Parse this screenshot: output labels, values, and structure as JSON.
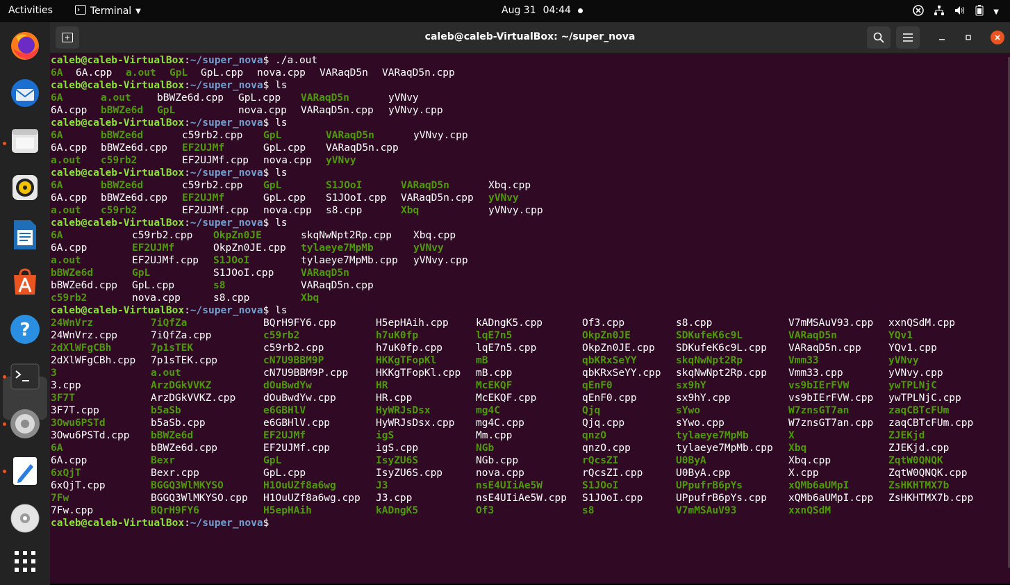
{
  "topbar": {
    "activities": "Activities",
    "app_name": "Terminal",
    "date": "Aug 31",
    "time": "04:44"
  },
  "dock": {
    "apps": [
      "firefox-icon",
      "thunderbird-icon",
      "files-icon",
      "rhythmbox-icon",
      "libreoffice-writer-icon",
      "app-center-icon",
      "help-icon",
      "terminal-icon",
      "settings-icon",
      "text-editor-icon",
      "disc-icon",
      "show-apps-icon"
    ]
  },
  "window": {
    "title": "caleb@caleb-VirtualBox: ~/super_nova"
  },
  "colors": {
    "terminal_bg": "#300a24",
    "prompt_user": "#8ae234",
    "prompt_path": "#729fcf",
    "executable": "#4e9a06",
    "accent_close": "#e95420"
  },
  "prompt": {
    "user": "caleb@caleb-VirtualBox",
    "sep": ":",
    "path": "~/super_nova",
    "dollar": "$ "
  },
  "commands": [
    "./a.out",
    "ls",
    "ls",
    "ls",
    "ls",
    "ls",
    "ls"
  ],
  "outputs": [
    [
      [
        [
          "6A",
          "g"
        ],
        [
          "6A.cpp",
          "f"
        ],
        [
          "a.out",
          "g"
        ],
        [
          "GpL",
          "g"
        ],
        [
          "GpL.cpp",
          "f"
        ],
        [
          "nova.cpp",
          "f"
        ],
        [
          "VARaqD5n",
          "f"
        ],
        [
          "VARaqD5n.cpp",
          "f"
        ]
      ]
    ],
    [
      [
        [
          "6A",
          "g"
        ],
        [
          "a.out",
          "g"
        ],
        [
          "bBWZe6d.cpp",
          "f"
        ],
        [
          "GpL.cpp",
          "f"
        ],
        [
          "VARaqD5n",
          "g"
        ],
        [
          "yVNvy",
          "f"
        ]
      ],
      [
        [
          "6A.cpp",
          "f"
        ],
        [
          "bBWZe6d",
          "g"
        ],
        [
          "GpL",
          "g"
        ],
        [
          "nova.cpp",
          "f"
        ],
        [
          "VARaqD5n.cpp",
          "f"
        ],
        [
          "yVNvy.cpp",
          "f"
        ]
      ]
    ],
    [
      [
        [
          "6A",
          "g"
        ],
        [
          "bBWZe6d",
          "g"
        ],
        [
          "c59rb2.cpp",
          "f"
        ],
        [
          "GpL",
          "g"
        ],
        [
          "VARaqD5n",
          "g"
        ],
        [
          "yVNvy.cpp",
          "f"
        ]
      ],
      [
        [
          "6A.cpp",
          "f"
        ],
        [
          "bBWZe6d.cpp",
          "f"
        ],
        [
          "EF2UJMf",
          "g"
        ],
        [
          "GpL.cpp",
          "f"
        ],
        [
          "VARaqD5n.cpp",
          "f"
        ]
      ],
      [
        [
          "a.out",
          "g"
        ],
        [
          "c59rb2",
          "g"
        ],
        [
          "EF2UJMf.cpp",
          "f"
        ],
        [
          "nova.cpp",
          "f"
        ],
        [
          "yVNvy",
          "g"
        ]
      ]
    ],
    [
      [
        [
          "6A",
          "g"
        ],
        [
          "bBWZe6d",
          "g"
        ],
        [
          "c59rb2.cpp",
          "f"
        ],
        [
          "GpL",
          "g"
        ],
        [
          "S1JOoI",
          "g"
        ],
        [
          "VARaqD5n",
          "g"
        ],
        [
          "Xbq.cpp",
          "f"
        ]
      ],
      [
        [
          "6A.cpp",
          "f"
        ],
        [
          "bBWZe6d.cpp",
          "f"
        ],
        [
          "EF2UJMf",
          "g"
        ],
        [
          "GpL.cpp",
          "f"
        ],
        [
          "S1JOoI.cpp",
          "f"
        ],
        [
          "VARaqD5n.cpp",
          "f"
        ],
        [
          "yVNvy",
          "g"
        ]
      ],
      [
        [
          "a.out",
          "g"
        ],
        [
          "c59rb2",
          "g"
        ],
        [
          "EF2UJMf.cpp",
          "f"
        ],
        [
          "nova.cpp",
          "f"
        ],
        [
          "s8.cpp",
          "f"
        ],
        [
          "Xbq",
          "g"
        ],
        [
          "yVNvy.cpp",
          "f"
        ]
      ]
    ],
    [
      [
        [
          "6A",
          "g"
        ],
        [
          "c59rb2.cpp",
          "f"
        ],
        [
          "OkpZn0JE",
          "g"
        ],
        [
          "skqNwNpt2Rp.cpp",
          "f"
        ],
        [
          "Xbq.cpp",
          "f"
        ]
      ],
      [
        [
          "6A.cpp",
          "f"
        ],
        [
          "EF2UJMf",
          "g"
        ],
        [
          "OkpZn0JE.cpp",
          "f"
        ],
        [
          "tylaeye7MpMb",
          "g"
        ],
        [
          "yVNvy",
          "g"
        ]
      ],
      [
        [
          "a.out",
          "g"
        ],
        [
          "EF2UJMf.cpp",
          "f"
        ],
        [
          "S1JOoI",
          "g"
        ],
        [
          "tylaeye7MpMb.cpp",
          "f"
        ],
        [
          "yVNvy.cpp",
          "f"
        ]
      ],
      [
        [
          "bBWZe6d",
          "g"
        ],
        [
          "GpL",
          "g"
        ],
        [
          "S1JOoI.cpp",
          "f"
        ],
        [
          "VARaqD5n",
          "g"
        ]
      ],
      [
        [
          "bBWZe6d.cpp",
          "f"
        ],
        [
          "GpL.cpp",
          "f"
        ],
        [
          "s8",
          "g"
        ],
        [
          "VARaqD5n.cpp",
          "f"
        ]
      ],
      [
        [
          "c59rb2",
          "g"
        ],
        [
          "nova.cpp",
          "f"
        ],
        [
          "s8.cpp",
          "f"
        ],
        [
          "Xbq",
          "g"
        ]
      ]
    ],
    [
      [
        [
          "24WnVrz",
          "g"
        ],
        [
          "7iQfZa",
          "g"
        ],
        [
          "BQrH9FY6.cpp",
          "f"
        ],
        [
          "H5epHAih.cpp",
          "f"
        ],
        [
          "kADngK5.cpp",
          "f"
        ],
        [
          "Of3.cpp",
          "f"
        ],
        [
          "s8.cpp",
          "f"
        ],
        [
          "V7mMSAuV93.cpp",
          "f"
        ],
        [
          "xxnQSdM.cpp",
          "f"
        ]
      ],
      [
        [
          "24WnVrz.cpp",
          "f"
        ],
        [
          "7iQfZa.cpp",
          "f"
        ],
        [
          "c59rb2",
          "g"
        ],
        [
          "h7uK0fp",
          "g"
        ],
        [
          "lqE7n5",
          "g"
        ],
        [
          "OkpZn0JE",
          "g"
        ],
        [
          "SDKufeK6c9L",
          "g"
        ],
        [
          "VARaqD5n",
          "g"
        ],
        [
          "YQv1",
          "g"
        ]
      ],
      [
        [
          "2dXlWFgCBh",
          "g"
        ],
        [
          "7p1sTEK",
          "g"
        ],
        [
          "c59rb2.cpp",
          "f"
        ],
        [
          "h7uK0fp.cpp",
          "f"
        ],
        [
          "lqE7n5.cpp",
          "f"
        ],
        [
          "OkpZn0JE.cpp",
          "f"
        ],
        [
          "SDKufeK6c9L.cpp",
          "f"
        ],
        [
          "VARaqD5n.cpp",
          "f"
        ],
        [
          "YQv1.cpp",
          "f"
        ]
      ],
      [
        [
          "2dXlWFgCBh.cpp",
          "f"
        ],
        [
          "7p1sTEK.cpp",
          "f"
        ],
        [
          "cN7U9BBM9P",
          "g"
        ],
        [
          "HKKgTFopKl",
          "g"
        ],
        [
          "mB",
          "g"
        ],
        [
          "qbKRxSeYY",
          "g"
        ],
        [
          "skqNwNpt2Rp",
          "g"
        ],
        [
          "Vmm33",
          "g"
        ],
        [
          "yVNvy",
          "g"
        ]
      ],
      [
        [
          "3",
          "g"
        ],
        [
          "a.out",
          "g"
        ],
        [
          "cN7U9BBM9P.cpp",
          "f"
        ],
        [
          "HKKgTFopKl.cpp",
          "f"
        ],
        [
          "mB.cpp",
          "f"
        ],
        [
          "qbKRxSeYY.cpp",
          "f"
        ],
        [
          "skqNwNpt2Rp.cpp",
          "f"
        ],
        [
          "Vmm33.cpp",
          "f"
        ],
        [
          "yVNvy.cpp",
          "f"
        ]
      ],
      [
        [
          "3.cpp",
          "f"
        ],
        [
          "ArzDGkVVKZ",
          "g"
        ],
        [
          "dOuBwdYw",
          "g"
        ],
        [
          "HR",
          "g"
        ],
        [
          "McEKQF",
          "g"
        ],
        [
          "qEnF0",
          "g"
        ],
        [
          "sx9hY",
          "g"
        ],
        [
          "vs9bIErFVW",
          "g"
        ],
        [
          "ywTPLNjC",
          "g"
        ]
      ],
      [
        [
          "3F7T",
          "g"
        ],
        [
          "ArzDGkVVKZ.cpp",
          "f"
        ],
        [
          "dOuBwdYw.cpp",
          "f"
        ],
        [
          "HR.cpp",
          "f"
        ],
        [
          "McEKQF.cpp",
          "f"
        ],
        [
          "qEnF0.cpp",
          "f"
        ],
        [
          "sx9hY.cpp",
          "f"
        ],
        [
          "vs9bIErFVW.cpp",
          "f"
        ],
        [
          "ywTPLNjC.cpp",
          "f"
        ]
      ],
      [
        [
          "3F7T.cpp",
          "f"
        ],
        [
          "b5aSb",
          "g"
        ],
        [
          "e6GBHlV",
          "g"
        ],
        [
          "HyWRJsDsx",
          "g"
        ],
        [
          "mg4C",
          "g"
        ],
        [
          "Qjq",
          "g"
        ],
        [
          "sYwo",
          "g"
        ],
        [
          "W7znsGT7an",
          "g"
        ],
        [
          "zaqCBTcFUm",
          "g"
        ]
      ],
      [
        [
          "3Owu6PSTd",
          "g"
        ],
        [
          "b5aSb.cpp",
          "f"
        ],
        [
          "e6GBHlV.cpp",
          "f"
        ],
        [
          "HyWRJsDsx.cpp",
          "f"
        ],
        [
          "mg4C.cpp",
          "f"
        ],
        [
          "Qjq.cpp",
          "f"
        ],
        [
          "sYwo.cpp",
          "f"
        ],
        [
          "W7znsGT7an.cpp",
          "f"
        ],
        [
          "zaqCBTcFUm.cpp",
          "f"
        ]
      ],
      [
        [
          "3Owu6PSTd.cpp",
          "f"
        ],
        [
          "bBWZe6d",
          "g"
        ],
        [
          "EF2UJMf",
          "g"
        ],
        [
          "igS",
          "g"
        ],
        [
          "Mm.cpp",
          "f"
        ],
        [
          "qnzO",
          "g"
        ],
        [
          "tylaeye7MpMb",
          "g"
        ],
        [
          "X",
          "g"
        ],
        [
          "ZJEKjd",
          "g"
        ]
      ],
      [
        [
          "6A",
          "g"
        ],
        [
          "bBWZe6d.cpp",
          "f"
        ],
        [
          "EF2UJMf.cpp",
          "f"
        ],
        [
          "igS.cpp",
          "f"
        ],
        [
          "NGb",
          "g"
        ],
        [
          "qnzO.cpp",
          "f"
        ],
        [
          "tylaeye7MpMb.cpp",
          "f"
        ],
        [
          "Xbq",
          "g"
        ],
        [
          "ZJEKjd.cpp",
          "f"
        ]
      ],
      [
        [
          "6A.cpp",
          "f"
        ],
        [
          "Bexr",
          "g"
        ],
        [
          "GpL",
          "g"
        ],
        [
          "IsyZU6S",
          "g"
        ],
        [
          "NGb.cpp",
          "f"
        ],
        [
          "rQcsZI",
          "g"
        ],
        [
          "U0ByA",
          "g"
        ],
        [
          "Xbq.cpp",
          "f"
        ],
        [
          "ZqtW0QNQK",
          "g"
        ]
      ],
      [
        [
          "6xQjT",
          "g"
        ],
        [
          "Bexr.cpp",
          "f"
        ],
        [
          "GpL.cpp",
          "f"
        ],
        [
          "IsyZU6S.cpp",
          "f"
        ],
        [
          "nova.cpp",
          "f"
        ],
        [
          "rQcsZI.cpp",
          "f"
        ],
        [
          "U0ByA.cpp",
          "f"
        ],
        [
          "X.cpp",
          "f"
        ],
        [
          "ZqtW0QNQK.cpp",
          "f"
        ]
      ],
      [
        [
          "6xQjT.cpp",
          "f"
        ],
        [
          "BGGQ3WlMKYSO",
          "g"
        ],
        [
          "H1OuUZf8a6wg",
          "g"
        ],
        [
          "J3",
          "g"
        ],
        [
          "nsE4UIiAe5W",
          "g"
        ],
        [
          "S1JOoI",
          "g"
        ],
        [
          "UPpufrB6pYs",
          "g"
        ],
        [
          "xQMb6aUMpI",
          "g"
        ],
        [
          "ZsHKHTMX7b",
          "g"
        ]
      ],
      [
        [
          "7Fw",
          "g"
        ],
        [
          "BGGQ3WlMKYSO.cpp",
          "f"
        ],
        [
          "H1OuUZf8a6wg.cpp",
          "f"
        ],
        [
          "J3.cpp",
          "f"
        ],
        [
          "nsE4UIiAe5W.cpp",
          "f"
        ],
        [
          "S1JOoI.cpp",
          "f"
        ],
        [
          "UPpufrB6pYs.cpp",
          "f"
        ],
        [
          "xQMb6aUMpI.cpp",
          "f"
        ],
        [
          "ZsHKHTMX7b.cpp",
          "f"
        ]
      ],
      [
        [
          "7Fw.cpp",
          "f"
        ],
        [
          "BQrH9FY6",
          "g"
        ],
        [
          "H5epHAih",
          "g"
        ],
        [
          "kADngK5",
          "g"
        ],
        [
          "Of3",
          "g"
        ],
        [
          "s8",
          "g"
        ],
        [
          "V7mMSAuV93",
          "g"
        ],
        [
          "xxnQSdM",
          "g"
        ]
      ]
    ]
  ]
}
